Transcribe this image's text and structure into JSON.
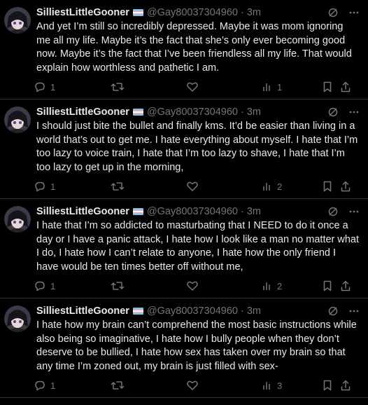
{
  "tweets": [
    {
      "name": "SilliestLittleGooner",
      "handle": "@Gay80037304960",
      "time": "3m",
      "text": "And yet I’m still so incredibly depressed. Maybe it was mom ignoring me all my life. Maybe it’s the fact that she’s only ever becoming good now. Maybe it’s the fact that I’ve been friendless all my life. That would explain how worthless and pathetic I am.",
      "replies": "1",
      "retweets": "",
      "likes": "",
      "views": "1"
    },
    {
      "name": "SilliestLittleGooner",
      "handle": "@Gay80037304960",
      "time": "3m",
      "text": "I should just bite the bullet and finally kms. It’d be easier than living in a world that’s out to get me. I hate everything about myself. I hate that I’m too lazy to voice train, I hate that I’m too lazy to shave, I hate that I’m too lazy to get up in the morning,",
      "replies": "1",
      "retweets": "",
      "likes": "",
      "views": "2"
    },
    {
      "name": "SilliestLittleGooner",
      "handle": "@Gay80037304960",
      "time": "3m",
      "text": "I hate that I’m so addicted to masturbating that I NEED to do it once a day or I have a panic attack, I hate how I look like a man no matter what I do, I hate how I can’t relate to anyone, I hate how the only friend I have would be ten times better off without me,",
      "replies": "1",
      "retweets": "",
      "likes": "",
      "views": "2"
    },
    {
      "name": "SilliestLittleGooner",
      "handle": "@Gay80037304960",
      "time": "3m",
      "text": "I hate how my brain can’t comprehend the most basic instructions while also being so imaginative, I hate how I bully people when they don’t deserve to be bullied, I hate how sex has taken over my brain so that any time I’m zoned out, my brain is just filled with sex-",
      "replies": "1",
      "retweets": "",
      "likes": "",
      "views": "3"
    }
  ],
  "icons": {
    "grok": "grok-icon",
    "more": "more-icon",
    "reply": "reply-icon",
    "retweet": "retweet-icon",
    "like": "like-icon",
    "views": "views-icon",
    "bookmark": "bookmark-icon",
    "share": "share-icon"
  },
  "colors": {
    "background": "#000000",
    "text": "#e7e9ea",
    "muted": "#71767b",
    "divider": "#2f3336"
  }
}
